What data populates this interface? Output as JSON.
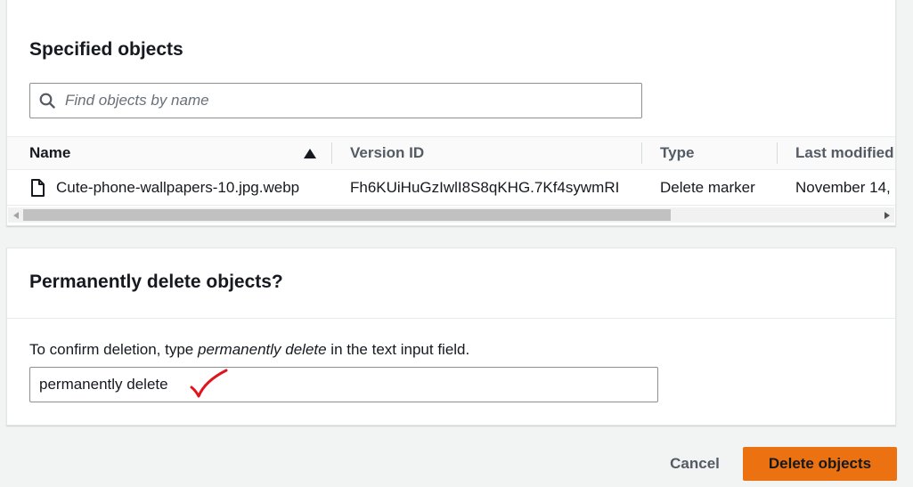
{
  "specified": {
    "title": "Specified objects",
    "search_placeholder": "Find objects by name"
  },
  "table": {
    "columns": [
      {
        "label": "Name",
        "sorted": "ascending"
      },
      {
        "label": "Version ID"
      },
      {
        "label": "Type"
      },
      {
        "label": "Last modified"
      }
    ],
    "rows": [
      {
        "name": "Cute-phone-wallpapers-10.jpg.webp",
        "version_id": "Fh6KUiHuGzIwlI8S8qKHG.7Kf4sywmRI",
        "type": "Delete marker",
        "last_modified": "November 14,"
      }
    ]
  },
  "confirm": {
    "title": "Permanently delete objects?",
    "instruction_before": "To confirm deletion, type ",
    "instruction_phrase": "permanently delete",
    "instruction_after": " in the text input field.",
    "input_value": "permanently delete"
  },
  "footer": {
    "cancel_label": "Cancel",
    "delete_label": "Delete objects"
  },
  "colors": {
    "primary_button": "#ec7211",
    "annotation_check": "#e0141e"
  }
}
